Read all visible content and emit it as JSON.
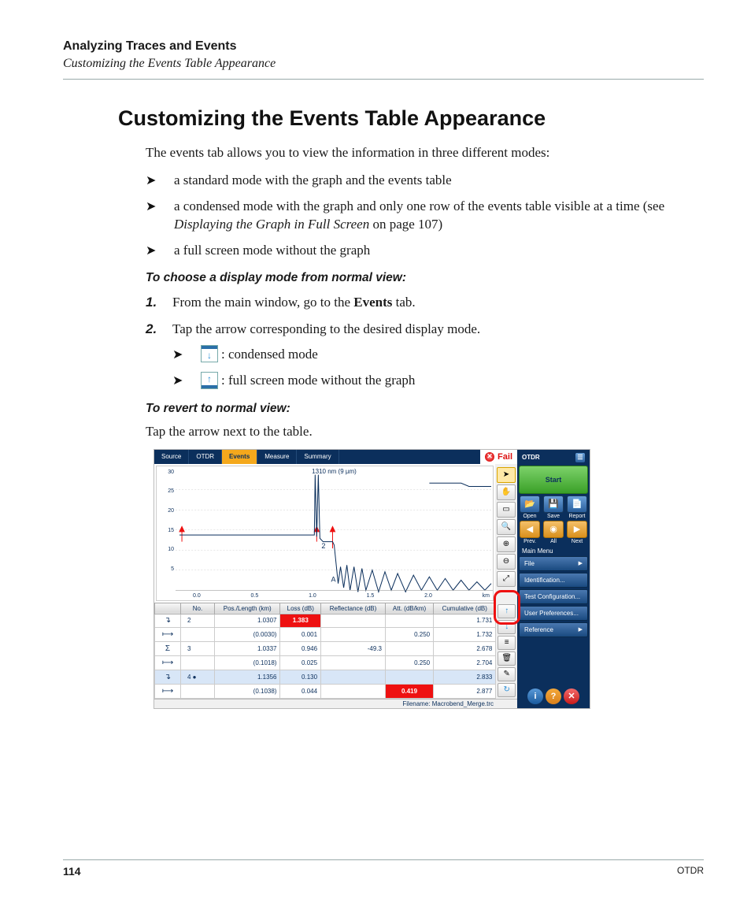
{
  "header": {
    "chapter": "Analyzing Traces and Events",
    "section": "Customizing the Events Table Appearance"
  },
  "title": "Customizing the Events Table Appearance",
  "intro": "The events tab allows you to view the information in three different modes:",
  "modes": {
    "m1": "a standard mode with the graph and the events table",
    "m2_a": "a condensed mode with the graph and only one row of the events table visible at a time (see ",
    "m2_it": "Displaying the Graph in Full Screen",
    "m2_b": " on page 107)",
    "m3": "a full screen mode without the graph"
  },
  "subhead1": "To choose a display mode from normal view:",
  "steps": {
    "s1_a": "From the main window, go to the ",
    "s1_bold": "Events",
    "s1_b": " tab.",
    "s2": "Tap the arrow corresponding to the desired display mode."
  },
  "submodes": {
    "a": ": condensed mode",
    "b": ": full screen mode without the graph"
  },
  "subhead2": "To revert to normal view:",
  "revert": "Tap the arrow next to the table.",
  "screenshot": {
    "tabs": {
      "t1": "Source",
      "t2": "OTDR",
      "t3": "Events",
      "t4": "Measure",
      "t5": "Summary"
    },
    "fail": "Fail",
    "graph_label": "1310 nm (9 µm)",
    "yaxis": {
      "y30": "30",
      "y25": "25",
      "y20": "20",
      "y15": "15",
      "y10": "10",
      "y5": "5"
    },
    "xaxis": {
      "x0": "0.0",
      "x1": "0.5",
      "x2": "1.0",
      "x3": "1.5",
      "x4": "2.0",
      "xu": "km"
    },
    "markers": {
      "m2": "2",
      "mA": "A"
    },
    "table": {
      "cols": {
        "c1": "No.",
        "c2": "Pos./Length (km)",
        "c3": "Loss (dB)",
        "c4": "Reflectance (dB)",
        "c5": "Att. (dB/km)",
        "c6": "Cumulative (dB)"
      },
      "rows": [
        {
          "ico": "↴",
          "no": "2",
          "pos": "1.0307",
          "loss": "1.383",
          "loss_red": true,
          "ref": "",
          "att": "",
          "cum": "1.731"
        },
        {
          "ico": "⟼",
          "no": "",
          "pos": "(0.0030)",
          "loss": "0.001",
          "ref": "",
          "att": "0.250",
          "cum": "1.732"
        },
        {
          "ico": "Σ",
          "no": "3",
          "pos": "1.0337",
          "loss": "0.946",
          "ref": "-49.3",
          "att": "",
          "cum": "2.678"
        },
        {
          "ico": "⟼",
          "no": "",
          "pos": "(0.1018)",
          "loss": "0.025",
          "ref": "",
          "att": "0.250",
          "cum": "2.704"
        },
        {
          "ico": "↴",
          "no": "4 ●",
          "pos": "1.1356",
          "loss": "0.130",
          "ref": "",
          "att": "",
          "cum": "2.833",
          "sel": true
        },
        {
          "ico": "⟼",
          "no": "",
          "pos": "(0.1038)",
          "loss": "0.044",
          "ref": "",
          "att": "0.419",
          "att_red": true,
          "cum": "2.877"
        }
      ]
    },
    "filename": "Filename: Macrobend_Merge.trc",
    "sidebar": {
      "title": "OTDR",
      "start": "Start",
      "row1": {
        "b1": "Open",
        "b2": "Save",
        "b3": "Report"
      },
      "row2": {
        "b1": "Prev.",
        "b2": "All",
        "b3": "Next"
      },
      "menu_label": "Main Menu",
      "items": {
        "i1": "File",
        "i2": "Identification...",
        "i3": "Test Configuration...",
        "i4": "User Preferences...",
        "i5": "Reference"
      }
    }
  },
  "footer": {
    "page": "114",
    "doc": "OTDR"
  }
}
